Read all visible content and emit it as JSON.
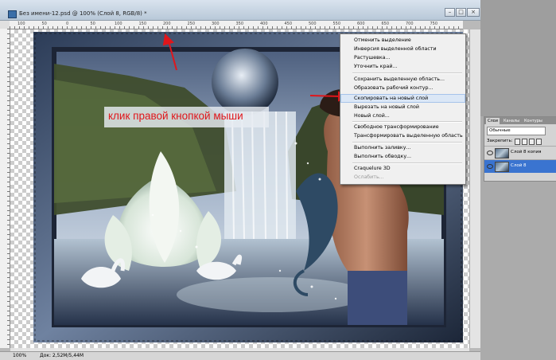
{
  "document": {
    "title": "Без имени-12.psd @ 100% (Слой 8, RGB/8) *",
    "ruler_ticks": [
      "100",
      "50",
      "0",
      "50",
      "100",
      "150",
      "200",
      "250",
      "300",
      "350",
      "400",
      "450",
      "500",
      "550",
      "600",
      "650",
      "700",
      "750"
    ],
    "status_zoom": "100%",
    "status_doc": "Док: 2,52М/5,44М",
    "zoom_left": "100%"
  },
  "annotation": {
    "callout_text": "клик правой кнопкой мыши",
    "arrow_color": "#e0161b"
  },
  "context_menu": {
    "items": [
      {
        "label": "Отменить выделение"
      },
      {
        "label": "Инверсия выделенной области"
      },
      {
        "label": "Растушевка..."
      },
      {
        "label": "Уточнить край..."
      },
      {
        "label": "Сохранить выделенную область..."
      },
      {
        "label": "Образовать рабочий контур..."
      },
      {
        "label": "Скопировать на новый слой",
        "highlighted": true
      },
      {
        "label": "Вырезать на новый слой"
      },
      {
        "label": "Новый слой..."
      },
      {
        "label": "Свободное трансформирование"
      },
      {
        "label": "Трансформировать выделенную область"
      },
      {
        "label": "Выполнить заливку..."
      },
      {
        "label": "Выполнить обводку..."
      },
      {
        "label": "Craquelure 3D"
      },
      {
        "label": "Ослабить...",
        "disabled": true
      }
    ]
  },
  "layers_panel": {
    "tabs": [
      "Слои",
      "Каналы",
      "Контуры"
    ],
    "blend_mode": "Обычные",
    "lock_label": "Закрепить:",
    "layers": [
      {
        "name": "Слой 8 копия",
        "selected": false
      },
      {
        "name": "Слой 8",
        "selected": true
      }
    ],
    "selected_color": "#3a74d0"
  }
}
